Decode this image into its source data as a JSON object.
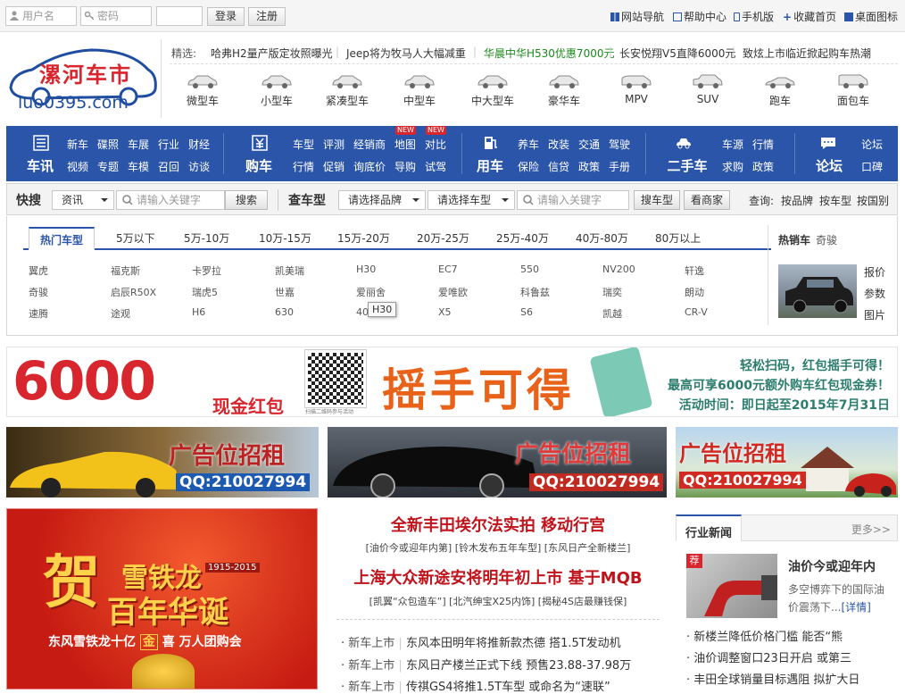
{
  "topbar": {
    "username_placeholder": "用户名",
    "password_placeholder": "密码",
    "login_label": "登录",
    "register_label": "注册",
    "links": [
      "网站导航",
      "帮助中心",
      "手机版",
      "收藏首页",
      "桌面图标"
    ]
  },
  "logo": {
    "cn": "漯河车市",
    "en": "luo0395.com"
  },
  "ticker": {
    "prefix": "精选:",
    "items": [
      "哈弗H2量产版定妆照曝光",
      "Jeep将为牧马人大幅减重",
      "华晨中华H530优惠7000元",
      "长安悦翔V5直降6000元",
      "致炫上市临近掀起购车热潮"
    ]
  },
  "car_types": [
    "微型车",
    "小型车",
    "紧凑型车",
    "中型车",
    "中大型车",
    "豪华车",
    "MPV",
    "SUV",
    "跑车",
    "面包车"
  ],
  "nav": {
    "new_tag": "NEW",
    "groups": [
      {
        "title": "车讯",
        "links": [
          "新车",
          "碟照",
          "车展",
          "行业",
          "财经",
          "视频",
          "专题",
          "车模",
          "召回",
          "访谈"
        ]
      },
      {
        "title": "购车",
        "links": [
          "车型",
          "评测",
          "经销商",
          "地图",
          "对比",
          "行情",
          "促销",
          "询底价",
          "导购",
          "试驾"
        ]
      },
      {
        "title": "用车",
        "links": [
          "养车",
          "改装",
          "交通",
          "驾驶",
          "保险",
          "信贷",
          "政策",
          "手册"
        ]
      },
      {
        "title": "二手车",
        "links": [
          "车源",
          "行情",
          "求购",
          "政策"
        ]
      },
      {
        "title": "论坛",
        "links": [
          "论坛",
          "口碑"
        ]
      }
    ]
  },
  "search": {
    "quick_label": "快搜",
    "category": "资讯",
    "keyword_placeholder": "请输入关键字",
    "search_btn": "搜索",
    "find_label": "查车型",
    "brand_select": "请选择品牌",
    "model_select": "请选择车型",
    "keyword2_placeholder": "请输入关键字",
    "find_btn": "搜车型",
    "dealer_btn": "看商家",
    "query_label": "查询:",
    "query_links": [
      "按品牌",
      "按车型",
      "按国别"
    ]
  },
  "hot": {
    "tabs": [
      "热门车型",
      "5万以下",
      "5万-10万",
      "10万-15万",
      "15万-20万",
      "20万-25万",
      "25万-40万",
      "40万-80万",
      "80万以上"
    ],
    "rows": [
      [
        "翼虎",
        "福克斯",
        "卡罗拉",
        "凯美瑞",
        "H30",
        "EC7",
        "550",
        "NV200",
        "轩逸"
      ],
      [
        "奇骏",
        "启辰R50X",
        "瑞虎5",
        "世嘉",
        "爱丽舍",
        "爱唯欧",
        "科鲁兹",
        "瑞奕",
        "朗动"
      ],
      [
        "速腾",
        "途观",
        "H6",
        "630",
        "408",
        "X5",
        "S6",
        "凯越",
        "CR-V"
      ]
    ],
    "tooltip": "H30",
    "selling_title": "热销车",
    "selling_name": "奇骏",
    "selling_links": [
      "报价",
      "参数",
      "图片"
    ]
  },
  "banner": {
    "amount": "6000",
    "sub": "现金红包",
    "qr_caption": "扫描二维码参与活动",
    "slogan": "摇手可得",
    "lines": [
      "轻松扫码，红包摇手可得！",
      "最高可享6000元额外购车红包现金券！",
      "活动时间：即日起至2015年7月31日"
    ]
  },
  "ads": [
    {
      "text": "广告位招租",
      "qq": "QQ:210027994"
    },
    {
      "text": "广告位招租",
      "qq": "QQ:210027994"
    },
    {
      "text": "广告位招租",
      "qq": "QQ:210027994"
    }
  ],
  "promo": {
    "years": "1915-2015",
    "title1": "贺",
    "title2": "雪铁龙",
    "title3": "百年华诞",
    "line": "东风雪铁龙十亿",
    "gold": "金",
    "line2": "喜 万人团购会"
  },
  "news": {
    "headline1": "全新丰田埃尔法实拍 移动行宫",
    "sub1": "[油价今或迎年内第] [铃木发布五年车型] [东风日产全新楼兰]",
    "headline2": "上海大众新途安将明年初上市 基于MQB",
    "sub2": "[凯翼“众包造车”] [北汽绅宝X25内饰] [揭秘4S店最赚钱保]",
    "items": [
      {
        "cat": "新车上市",
        "title": "东风本田明年将推新款杰德 搭1.5T发动机"
      },
      {
        "cat": "新车上市",
        "title": "东风日产楼兰正式下线 预售23.88-37.98万"
      },
      {
        "cat": "新车上市",
        "title": "传祺GS4将推1.5T车型 或命名为“速联”"
      }
    ]
  },
  "side": {
    "title": "行业新闻",
    "more": "更多>>",
    "badge": "荐",
    "feature_title": "油价今或迎年内",
    "feature_text": "多空博弈下的国际油价震荡下...",
    "detail": "[详情]",
    "items": [
      "新楼兰降低价格门槛 能否“熊",
      "油价调整窗口23日开启 或第三",
      "丰田全球销量目标遇阻 拟扩大日"
    ]
  }
}
